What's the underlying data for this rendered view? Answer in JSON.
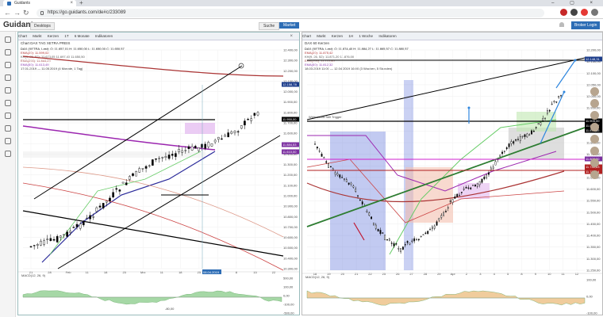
{
  "browser": {
    "tab_title": "Guidants",
    "url": "https://go.guidants.com/de#c/233089",
    "colors": {
      "accent": "#2d6db5"
    }
  },
  "app": {
    "logo": "Guidants",
    "desktop_button": "Desktops",
    "search_button": "Suche",
    "market_button": "Market",
    "broker_button": "Broker Login"
  },
  "left_chart": {
    "title": "Chart DAX TAG XETRA PREIS",
    "toolbar": [
      "Chart",
      "Markt",
      "Kerzen",
      "1T",
      "6 Monate",
      "Indikatoren"
    ],
    "legend": [
      "DAX (XETRA, Last): O: 11.657,01  H: 11.650,00  L: 11.650,00  C: 11.650,57",
      "EMA(20): 11.599,02",
      "KH(9, 26, 52): 11.673,05  11.697,40  11.650,50",
      "EMA(200): 11.865,29",
      "EMA(50): 11.613,49",
      "17.01.2019 — 11.05.2019  (4 Monate, 1 Tag)"
    ],
    "y_ticks": [
      "12.400,00",
      "12.300,00",
      "12.200,00",
      "12.100,00",
      "12.000,00",
      "11.900,00",
      "11.800,00",
      "11.700,00",
      "11.600,00",
      "11.500,00",
      "11.400,00",
      "11.300,00",
      "11.200,00",
      "11.100,00",
      "11.000,00",
      "10.900,00",
      "10.800,00",
      "10.700,00",
      "10.600,00",
      "10.500,00",
      "10.400,00",
      "10.300,00"
    ],
    "x_ticks": [
      "21",
      "28",
      "Feb",
      "11",
      "18",
      "25",
      "Mrz",
      "11",
      "18",
      "25",
      "Apr",
      "8",
      "15",
      "22"
    ],
    "price_labels": [
      {
        "text": "12.158,78",
        "color": "#1a3b8a"
      },
      {
        "text": "11.950,00",
        "color": "#000000"
      },
      {
        "text": "11.884,53",
        "color": "#7b2fa0"
      },
      {
        "text": "11.610,00",
        "color": "#7b2fa0"
      }
    ],
    "date_label": "08.04.2019",
    "indicator_label": "MACD(12, 26, 9)",
    "indicator_value": "-80,00",
    "indicator_ticks": [
      "500,00",
      "100,00",
      "0,00",
      "-100,00",
      "-500,00"
    ]
  },
  "right_chart": {
    "title": "DAX 60 Kerzen",
    "toolbar": [
      "Chart",
      "Markt",
      "Kerzen",
      "1H",
      "1 Woche",
      "Indikatoren"
    ],
    "legend": [
      "DAX (XETRA, Last): O: 11.874,40  H: 11.884,27  L: 11.865,57  C: 11.880,57",
      "EMA(20): 11.875,42",
      "KH(9, 26, 52): 11.871,20  11.876,00",
      "EMA(200): 11.710,40",
      "EMA(50): 11.812,32",
      "18.03.2019 11:00 — 12.04.2019 16:00  (3 Wochen, 5 Stunden)"
    ],
    "annotation_sell": "Widerstand Sell Trigger",
    "y_ticks": [
      "12.200,00",
      "12.150,00",
      "12.100,00",
      "12.050,00",
      "12.000,00",
      "11.950,00",
      "11.900,00",
      "11.850,00",
      "11.800,00",
      "11.750,00",
      "11.700,00",
      "11.650,00",
      "11.600,00",
      "11.550,00",
      "11.500,00",
      "11.450,00",
      "11.400,00",
      "11.350,00",
      "11.300,00",
      "11.250,00"
    ],
    "x_ticks": [
      "18",
      "19",
      "20",
      "21",
      "22",
      "25",
      "26",
      "27",
      "28",
      "29",
      "Apr",
      "2",
      "3",
      "4",
      "5",
      "8",
      "9",
      "10",
      "11",
      "12"
    ],
    "price_labels": [
      {
        "text": "12.148,31",
        "color": "#1a3b8a"
      },
      {
        "text": "11.905,00",
        "color": "#000000"
      },
      {
        "text": "11.894,17",
        "color": "#000000"
      },
      {
        "text": "11.871,35",
        "color": "#000000"
      },
      {
        "text": "11.800,00",
        "color": "#7b2fa0"
      },
      {
        "text": "11.741,63",
        "color": "#b02020"
      },
      {
        "text": "11.737,14",
        "color": "#b02020"
      }
    ],
    "indicator_label": "MACD(12, 26, 9)",
    "indicator_ticks": [
      "100,00",
      "0,00",
      "-100,00"
    ]
  }
}
